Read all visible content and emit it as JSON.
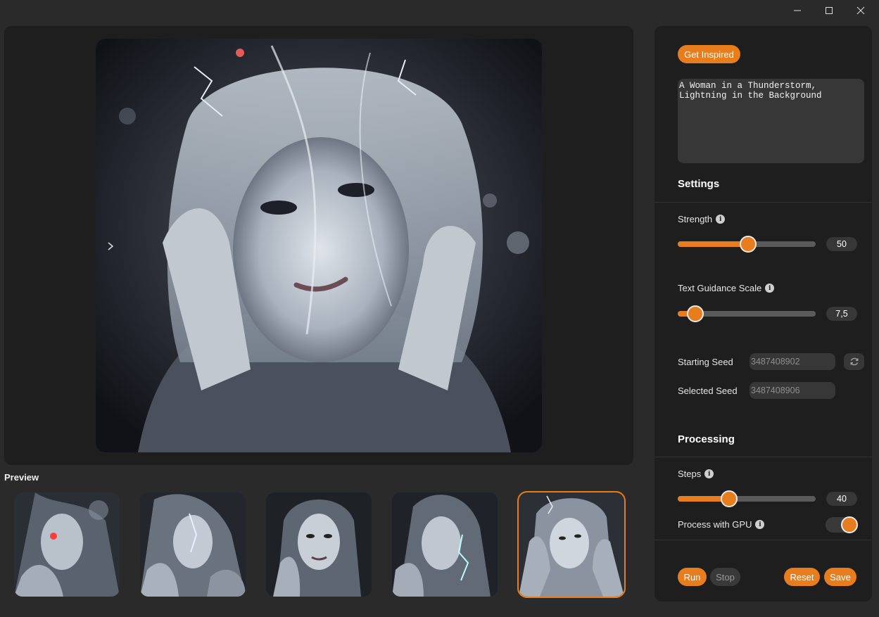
{
  "window": {
    "minimize_icon": "minimize-icon",
    "maximize_icon": "maximize-icon",
    "close_icon": "close-icon"
  },
  "canvas": {
    "image_description_icon": "generated-image",
    "nav_arrow": "›"
  },
  "preview": {
    "label": "Preview",
    "selected_index": 4,
    "count": 5
  },
  "panel": {
    "get_inspired_label": "Get Inspired",
    "prompt_value": "A Woman in a Thunderstorm, Lightning in the Background",
    "settings_title": "Settings",
    "strength": {
      "label": "Strength",
      "value": "50",
      "fraction": 0.51
    },
    "guidance": {
      "label": "Text Guidance Scale",
      "value": "7,5",
      "fraction": 0.13
    },
    "starting_seed": {
      "label": "Starting Seed",
      "value": "3487408902"
    },
    "selected_seed": {
      "label": "Selected Seed",
      "value": "3487408906"
    },
    "processing_title": "Processing",
    "steps": {
      "label": "Steps",
      "value": "40",
      "fraction": 0.37
    },
    "gpu": {
      "label": "Process with GPU",
      "enabled": true
    },
    "run_label": "Run",
    "stop_label": "Stop",
    "reset_label": "Reset",
    "save_label": "Save"
  },
  "colors": {
    "accent": "#e87d1e",
    "background": "#2b2a2b",
    "card": "#1f1e1f",
    "field": "#383738"
  }
}
